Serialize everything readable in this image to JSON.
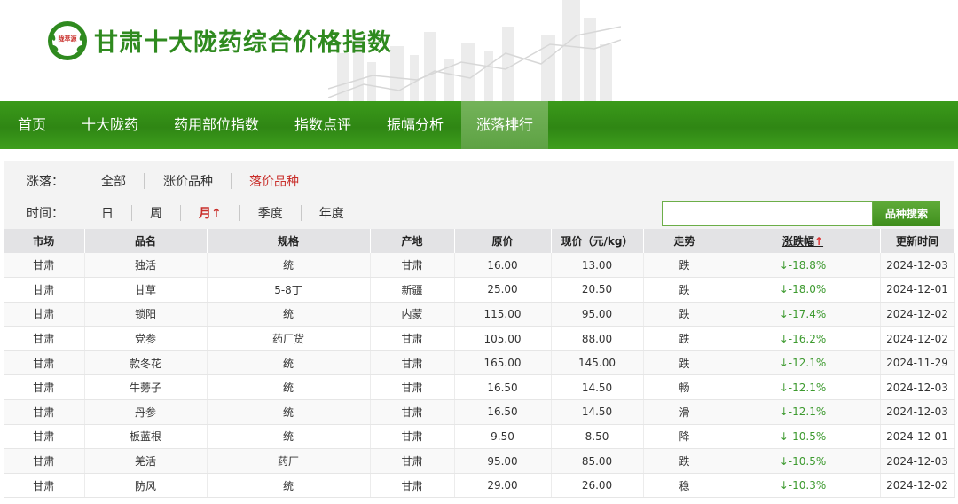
{
  "header": {
    "title": "甘肃十大陇药综合价格指数",
    "logo_text": "陇萃源"
  },
  "nav": {
    "items": [
      "首页",
      "十大陇药",
      "药用部位指数",
      "指数点评",
      "振幅分析",
      "涨落排行"
    ],
    "active_index": 5
  },
  "filters": {
    "change_label": "涨落：",
    "change_options": [
      "全部",
      "涨价品种",
      "落价品种"
    ],
    "change_selected": "落价品种",
    "time_label": "时间：",
    "time_options": [
      "日",
      "周",
      "月",
      "季度",
      "年度"
    ],
    "time_selected": "月",
    "time_sort_arrow": "↑"
  },
  "search": {
    "placeholder": "",
    "button_label": "品种搜索"
  },
  "table": {
    "headers": [
      "市场",
      "品名",
      "规格",
      "产地",
      "原价",
      "现价（元/kg）",
      "走势",
      "涨跌幅",
      "更新时间"
    ],
    "sort_arrow": "↑",
    "rows": [
      [
        "甘肃",
        "独活",
        "统",
        "甘肃",
        "16.00",
        "13.00",
        "跌",
        "↓-18.8%",
        "2024-12-03"
      ],
      [
        "甘肃",
        "甘草",
        "5-8丁",
        "新疆",
        "25.00",
        "20.50",
        "跌",
        "↓-18.0%",
        "2024-12-01"
      ],
      [
        "甘肃",
        "锁阳",
        "统",
        "内蒙",
        "115.00",
        "95.00",
        "跌",
        "↓-17.4%",
        "2024-12-02"
      ],
      [
        "甘肃",
        "党参",
        "药厂货",
        "甘肃",
        "105.00",
        "88.00",
        "跌",
        "↓-16.2%",
        "2024-12-02"
      ],
      [
        "甘肃",
        "款冬花",
        "统",
        "甘肃",
        "165.00",
        "145.00",
        "跌",
        "↓-12.1%",
        "2024-11-29"
      ],
      [
        "甘肃",
        "牛蒡子",
        "统",
        "甘肃",
        "16.50",
        "14.50",
        "畅",
        "↓-12.1%",
        "2024-12-03"
      ],
      [
        "甘肃",
        "丹参",
        "统",
        "甘肃",
        "16.50",
        "14.50",
        "滑",
        "↓-12.1%",
        "2024-12-03"
      ],
      [
        "甘肃",
        "板蓝根",
        "统",
        "甘肃",
        "9.50",
        "8.50",
        "降",
        "↓-10.5%",
        "2024-12-01"
      ],
      [
        "甘肃",
        "羌活",
        "药厂",
        "甘肃",
        "95.00",
        "85.00",
        "跌",
        "↓-10.5%",
        "2024-12-03"
      ],
      [
        "甘肃",
        "防风",
        "统",
        "甘肃",
        "29.00",
        "26.00",
        "稳",
        "↓-10.3%",
        "2024-12-02"
      ]
    ]
  },
  "colors": {
    "brand_green": "#2f8a1f",
    "nav_green": "#3b9a1a",
    "down_green": "#3d9a2f",
    "selected_red": "#c9302c"
  }
}
